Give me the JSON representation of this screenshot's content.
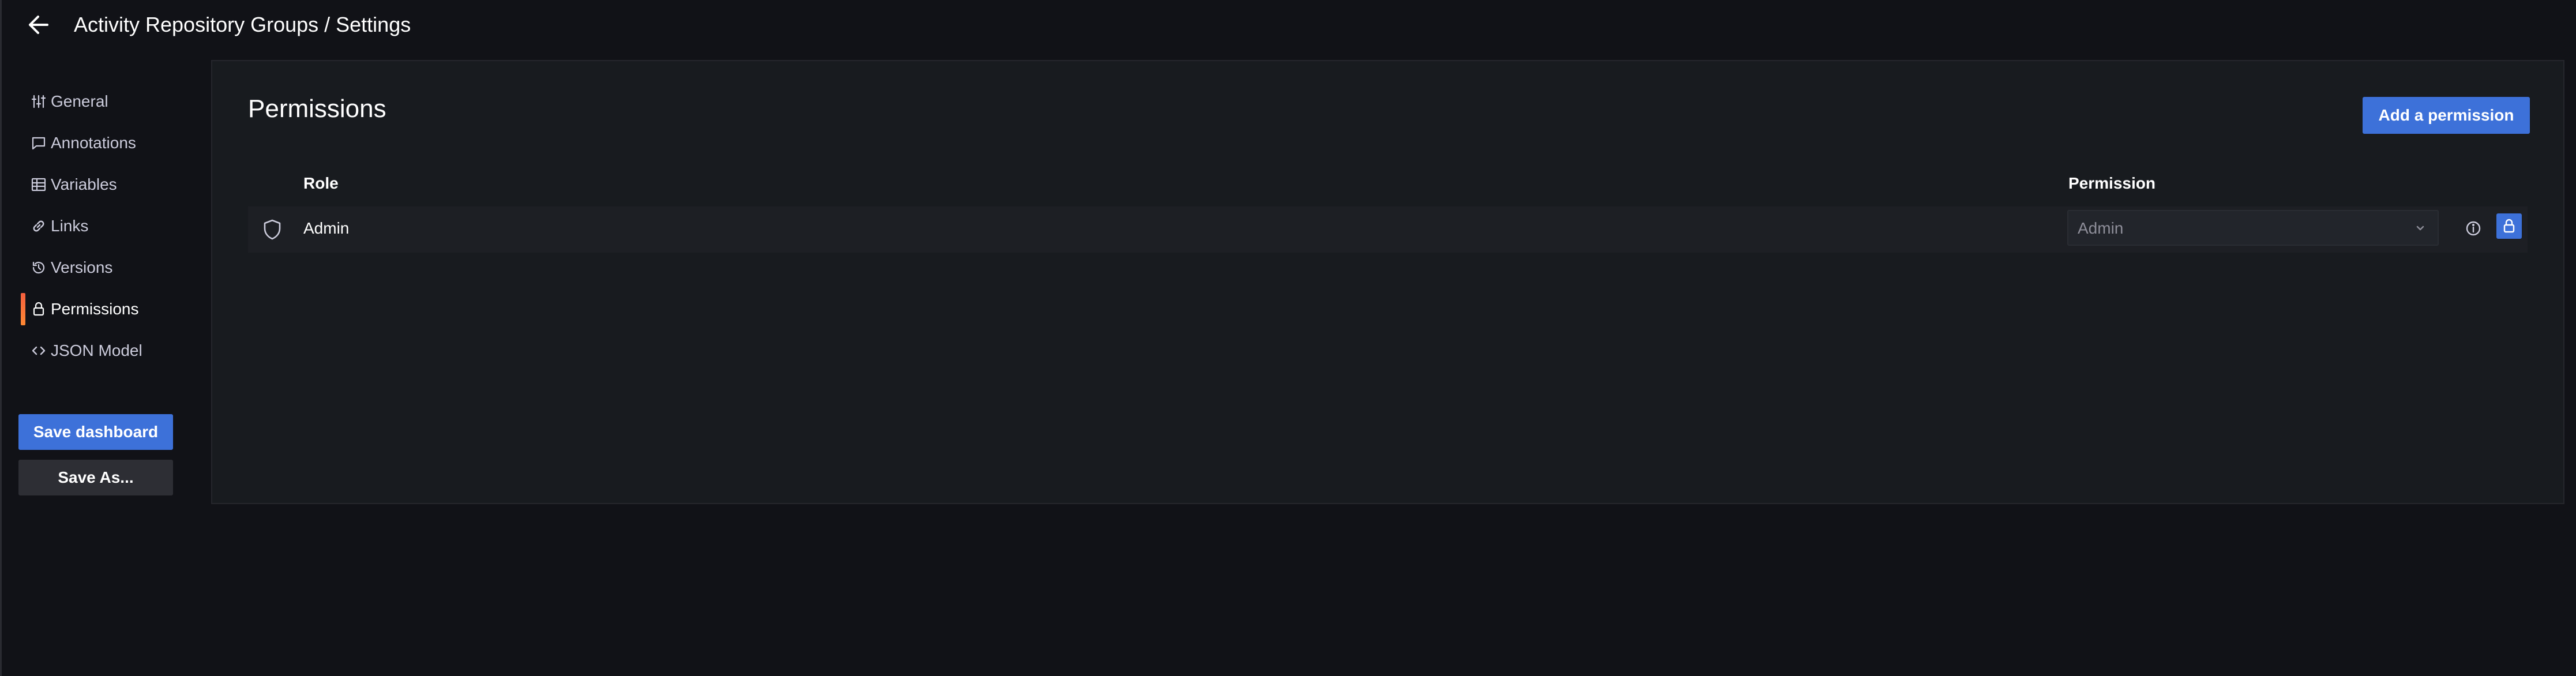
{
  "header": {
    "title": "Activity Repository Groups / Settings",
    "back_icon": "arrow-left-icon"
  },
  "sidebar": {
    "items": [
      {
        "label": "General",
        "icon": "sliders-icon"
      },
      {
        "label": "Annotations",
        "icon": "comment-icon"
      },
      {
        "label": "Variables",
        "icon": "variables-grid-icon"
      },
      {
        "label": "Links",
        "icon": "link-icon"
      },
      {
        "label": "Versions",
        "icon": "history-icon"
      },
      {
        "label": "Permissions",
        "icon": "lock-icon",
        "active": true
      },
      {
        "label": "JSON Model",
        "icon": "code-icon"
      }
    ],
    "save_dashboard_label": "Save dashboard",
    "save_as_label": "Save As..."
  },
  "permissions": {
    "title": "Permissions",
    "add_button_label": "Add a permission",
    "columns": {
      "role": "Role",
      "permission": "Permission"
    },
    "rows": [
      {
        "role": "Admin",
        "permission": "Admin",
        "icon": "shield-icon",
        "locked": true
      }
    ]
  },
  "colors": {
    "background": "#111217",
    "panel": "#181b1f",
    "primary": "#3d71d9",
    "active_indicator": "#f55f3e",
    "text": "#ccccdc"
  }
}
